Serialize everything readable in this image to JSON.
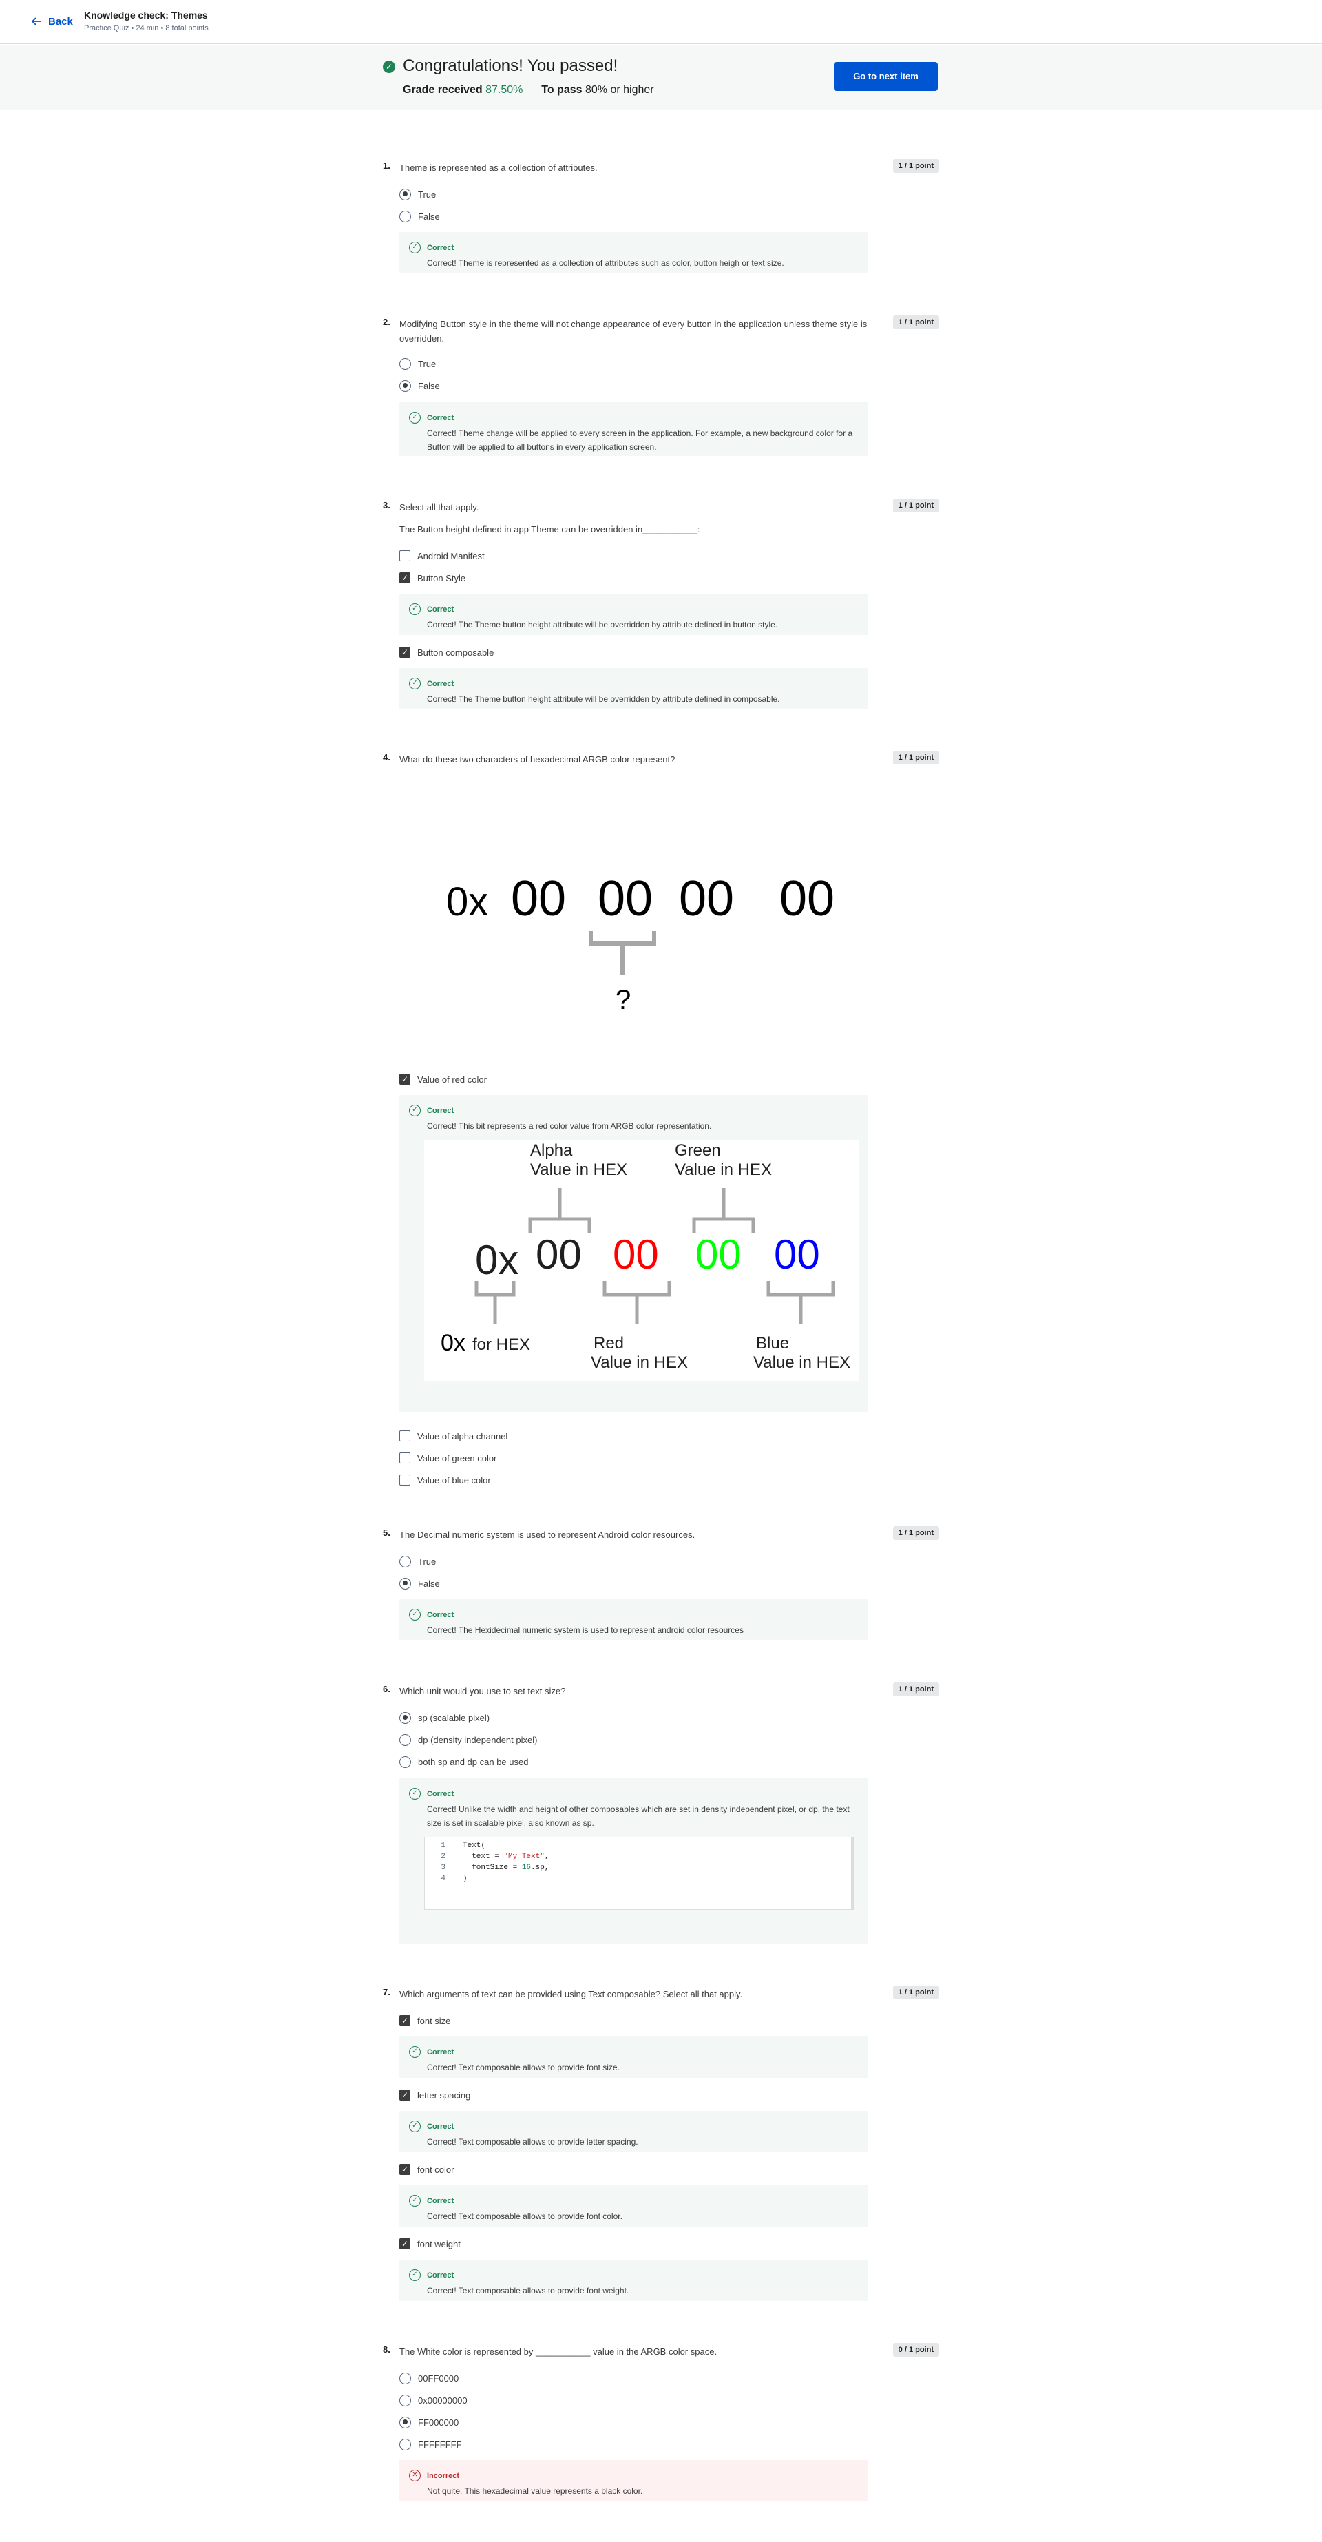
{
  "header": {
    "back_label": "Back",
    "title": "Knowledge check: Themes",
    "meta": "Practice Quiz • 24 min • 8 total points"
  },
  "banner": {
    "title": "Congratulations! You passed!",
    "grade_label": "Grade received",
    "grade_value": "87.50%",
    "pass_label": "To pass",
    "pass_value": "80% or higher",
    "next_button": "Go to next item"
  },
  "questions": [
    {
      "num": "1.",
      "text": "Theme is represented as a collection of attributes.",
      "points": "1 / 1 point",
      "options": [
        "True",
        "False"
      ],
      "selected": "True",
      "feedback": {
        "label": "Correct",
        "text": "Correct! Theme is represented as a collection of attributes such as color, button heigh or text size."
      }
    },
    {
      "num": "2.",
      "text": "Modifying Button style in the theme will not change appearance of every button in the application unless theme style is overridden.",
      "points": "1 / 1 point",
      "options": [
        "True",
        "False"
      ],
      "selected": "False",
      "feedback": {
        "label": "Correct",
        "text": "Correct! Theme change will be applied to every screen in the application. For example, a new background color for a Button will be applied to all buttons in every application screen."
      }
    },
    {
      "num": "3.",
      "text": "Select all that apply.",
      "subtext": "The Button height defined in app Theme can be overridden in___________:",
      "points": "1 / 1 point",
      "options": [
        "Android Manifest",
        "Button Style",
        "Button composable"
      ],
      "checked": [
        "Button Style",
        "Button composable"
      ],
      "feedback": [
        {
          "label": "Correct",
          "text": "Correct! The Theme button height attribute will be overridden by attribute defined in button style."
        },
        {
          "label": "Correct",
          "text": "Correct! The Theme button height attribute will be overridden by attribute defined in composable."
        }
      ]
    },
    {
      "num": "4.",
      "text": "What do these two characters of hexadecimal ARGB color represent?",
      "points": "1 / 1 point",
      "figure": {
        "prefix": "0x",
        "groups": [
          "00",
          "00",
          "00",
          "00"
        ],
        "question_mark": "?"
      },
      "options": [
        "Value of red color",
        "Value of alpha channel",
        "Value of green color",
        "Value of blue color"
      ],
      "checked": [
        "Value of red color"
      ],
      "feedback": {
        "label": "Correct",
        "text": "Correct! This bit represents a red color value from ARGB color representation."
      },
      "argb_figure": {
        "alpha_title": "Alpha",
        "alpha_sub": "Value in HEX",
        "green_title": "Green",
        "green_sub": "Value in HEX",
        "prefix": "0x",
        "alpha_val": "00",
        "red_val": "00",
        "green_val": "00",
        "blue_val": "00",
        "prefix_big": "0x",
        "prefix_note": "for HEX",
        "red_title": "Red",
        "red_sub": "Value in HEX",
        "blue_title": "Blue",
        "blue_sub": "Value in HEX",
        "colors": {
          "red": "#ff0000",
          "green": "#00ff00",
          "blue": "#0000ff"
        }
      }
    },
    {
      "num": "5.",
      "text": "The Decimal numeric system is used to represent Android color resources.",
      "points": "1 / 1 point",
      "options": [
        "True",
        "False"
      ],
      "selected": "False",
      "feedback": {
        "label": "Correct",
        "text": "Correct! The Hexidecimal numeric system is used to represent android color resources"
      }
    },
    {
      "num": "6.",
      "text": "Which unit would you use to set text size?",
      "points": "1 / 1 point",
      "options": [
        "sp (scalable pixel)",
        "dp (density independent pixel)",
        "both sp and dp can be used"
      ],
      "selected": "sp (scalable pixel)",
      "feedback": {
        "label": "Correct",
        "text": "Correct! Unlike the width and height of other composables which are set in density independent pixel, or dp, the text size is set in scalable pixel, also known as sp."
      },
      "code": {
        "line_numbers": [
          "1",
          "2",
          "3",
          "4"
        ],
        "l1": "Text(",
        "l2_a": "  text = ",
        "l2_str": "\"My Text\"",
        "l2_b": ",",
        "l3_a": "  fontSize = ",
        "l3_num": "16",
        "l3_b": ".sp,",
        "l4": ")"
      }
    },
    {
      "num": "7.",
      "text": "Which arguments of text can be provided using Text composable? Select all that apply.",
      "points": "1 / 1 point",
      "options": [
        "font size",
        "letter spacing",
        "font color",
        "font weight"
      ],
      "checked": [
        "font size",
        "letter spacing",
        "font color",
        "font weight"
      ],
      "feedback": [
        {
          "label": "Correct",
          "text": "Correct! Text composable allows to provide font size."
        },
        {
          "label": "Correct",
          "text": "Correct! Text composable allows to provide letter spacing."
        },
        {
          "label": "Correct",
          "text": "Correct! Text composable allows to provide font color."
        },
        {
          "label": "Correct",
          "text": "Correct! Text composable allows to provide font weight."
        }
      ]
    },
    {
      "num": "8.",
      "text": "The White color is represented by ___________ value in the ARGB color space.",
      "points": "0 / 1 point",
      "options": [
        "00FF0000",
        "0x00000000",
        "FF000000",
        "FFFFFFFF"
      ],
      "selected": "FF000000",
      "feedback": {
        "label": "Incorrect",
        "text": "Not quite. This hexadecimal value represents a black color."
      }
    }
  ]
}
